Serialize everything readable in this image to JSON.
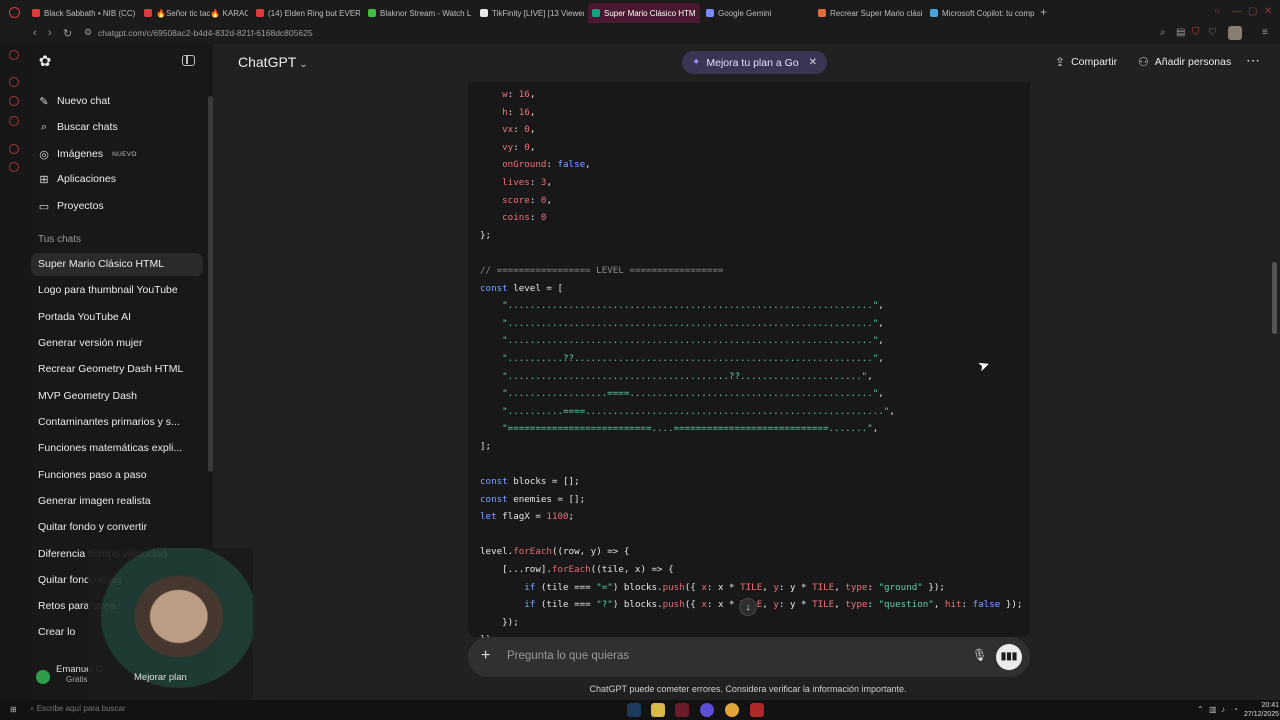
{
  "browser": {
    "tabs": [
      {
        "label": "Black Sabbath • NIB (CC) ..."
      },
      {
        "label": "🔥Señor tic tac🔥 KARAOK"
      },
      {
        "label": "(14) Elden Ring but EVERY"
      },
      {
        "label": "Blaknor Stream - Watch L"
      },
      {
        "label": "TikFinity [LIVE] [13 Viewer"
      },
      {
        "label": "Super Mario Clásico HTM"
      },
      {
        "label": "Google Gemini"
      },
      {
        "label": "Recrear Super Mario clási"
      },
      {
        "label": "Microsoft Copilot: tu comp"
      }
    ],
    "url": "chatgpt.com/c/69508ac2-b4d4-832d-821f-6168dc805625"
  },
  "sidebar": {
    "nav": [
      {
        "label": "Nuevo chat",
        "icon": "edit-icon"
      },
      {
        "label": "Buscar chats",
        "icon": "search-icon"
      },
      {
        "label": "Imágenes",
        "icon": "images-icon",
        "badge": "NUEVO"
      },
      {
        "label": "Aplicaciones",
        "icon": "apps-icon"
      },
      {
        "label": "Proyectos",
        "icon": "folder-icon"
      }
    ],
    "section_label": "Tus chats",
    "chats": [
      "Super Mario Clásico HTML",
      "Logo para thumbnail YouTube",
      "Portada YouTube AI",
      "Generar versión mujer",
      "Recrear Geometry Dash HTML",
      "MVP Geometry Dash",
      "Contaminantes primarios y s...",
      "Funciones matemáticas expli...",
      "Funciones paso a paso",
      "Generar imagen realista",
      "Quitar fondo y convertir",
      "Diferencia tiempo velocidad",
      "Quitar fondo imag",
      "Retos para strea",
      "Crear lo"
    ],
    "user_name": "Emanuel G",
    "user_plan": "Gratis",
    "upgrade_label": "Mejorar plan"
  },
  "header": {
    "title": "ChatGPT",
    "upsell": "Mejora tu plan a Go",
    "share": "Compartir",
    "add_people": "Añadir personas"
  },
  "code_lines": [
    [
      [
        "    ",
        ""
      ],
      [
        "w",
        "prop"
      ],
      [
        ": ",
        ""
      ],
      [
        "16",
        "num"
      ],
      [
        ",",
        ""
      ]
    ],
    [
      [
        "    ",
        ""
      ],
      [
        "h",
        "prop"
      ],
      [
        ": ",
        ""
      ],
      [
        "16",
        "num"
      ],
      [
        ",",
        ""
      ]
    ],
    [
      [
        "    ",
        ""
      ],
      [
        "vx",
        "prop"
      ],
      [
        ": ",
        ""
      ],
      [
        "0",
        "num"
      ],
      [
        ",",
        ""
      ]
    ],
    [
      [
        "    ",
        ""
      ],
      [
        "vy",
        "prop"
      ],
      [
        ": ",
        ""
      ],
      [
        "0",
        "num"
      ],
      [
        ",",
        ""
      ]
    ],
    [
      [
        "    ",
        ""
      ],
      [
        "onGround",
        "prop"
      ],
      [
        ": ",
        ""
      ],
      [
        "false",
        "bool"
      ],
      [
        ",",
        ""
      ]
    ],
    [
      [
        "    ",
        ""
      ],
      [
        "lives",
        "prop"
      ],
      [
        ": ",
        ""
      ],
      [
        "3",
        "num"
      ],
      [
        ",",
        ""
      ]
    ],
    [
      [
        "    ",
        ""
      ],
      [
        "score",
        "prop"
      ],
      [
        ": ",
        ""
      ],
      [
        "0",
        "num"
      ],
      [
        ",",
        ""
      ]
    ],
    [
      [
        "    ",
        ""
      ],
      [
        "coins",
        "prop"
      ],
      [
        ": ",
        ""
      ],
      [
        "0",
        "num"
      ]
    ],
    [
      [
        "};",
        ""
      ]
    ],
    [
      [
        "",
        ""
      ]
    ],
    [
      [
        "// ================= LEVEL =================",
        "cm"
      ]
    ],
    [
      [
        "const",
        "kw"
      ],
      [
        " level = [",
        ""
      ]
    ],
    [
      [
        "    ",
        ""
      ],
      [
        "\"..................................................................\"",
        "str"
      ],
      [
        ",",
        ""
      ]
    ],
    [
      [
        "    ",
        ""
      ],
      [
        "\"..................................................................\"",
        "str"
      ],
      [
        ",",
        ""
      ]
    ],
    [
      [
        "    ",
        ""
      ],
      [
        "\"..................................................................\"",
        "str"
      ],
      [
        ",",
        ""
      ]
    ],
    [
      [
        "    ",
        ""
      ],
      [
        "\"..........??......................................................\"",
        "str"
      ],
      [
        ",",
        ""
      ]
    ],
    [
      [
        "    ",
        ""
      ],
      [
        "\"........................................??......................\"",
        "str"
      ],
      [
        ",",
        ""
      ]
    ],
    [
      [
        "    ",
        ""
      ],
      [
        "\"..................====............................................\"",
        "str"
      ],
      [
        ",",
        ""
      ]
    ],
    [
      [
        "    ",
        ""
      ],
      [
        "\"..........====......................................................\"",
        "str"
      ],
      [
        ",",
        ""
      ]
    ],
    [
      [
        "    ",
        ""
      ],
      [
        "\"==========================....============================.......\"",
        "str"
      ],
      [
        ",",
        ""
      ]
    ],
    [
      [
        "];",
        ""
      ]
    ],
    [
      [
        "",
        ""
      ]
    ],
    [
      [
        "const",
        "kw"
      ],
      [
        " blocks = [];",
        ""
      ]
    ],
    [
      [
        "const",
        "kw"
      ],
      [
        " enemies = [];",
        ""
      ]
    ],
    [
      [
        "let",
        "kw"
      ],
      [
        " flagX = ",
        ""
      ],
      [
        "1100",
        "num"
      ],
      [
        ";",
        ""
      ]
    ],
    [
      [
        "",
        ""
      ]
    ],
    [
      [
        "level.",
        ""
      ],
      [
        "forEach",
        "fn"
      ],
      [
        "((row, y) => {",
        ""
      ]
    ],
    [
      [
        "    [...row].",
        ""
      ],
      [
        "forEach",
        "fn"
      ],
      [
        "((tile, x) => {",
        ""
      ]
    ],
    [
      [
        "        ",
        ""
      ],
      [
        "if",
        "kw"
      ],
      [
        " (tile === ",
        ""
      ],
      [
        "\"=\"",
        "str"
      ],
      [
        ") blocks.",
        ""
      ],
      [
        "push",
        "fn"
      ],
      [
        "({ ",
        ""
      ],
      [
        "x",
        "prop"
      ],
      [
        ": x * ",
        ""
      ],
      [
        "TILE",
        "prop"
      ],
      [
        ", ",
        ""
      ],
      [
        "y",
        "prop"
      ],
      [
        ": y * ",
        ""
      ],
      [
        "TILE",
        "prop"
      ],
      [
        ", ",
        ""
      ],
      [
        "type",
        "prop"
      ],
      [
        ": ",
        ""
      ],
      [
        "\"ground\"",
        "str"
      ],
      [
        " });",
        ""
      ]
    ],
    [
      [
        "        ",
        ""
      ],
      [
        "if",
        "kw"
      ],
      [
        " (tile === ",
        ""
      ],
      [
        "\"?\"",
        "str"
      ],
      [
        ") blocks.",
        ""
      ],
      [
        "push",
        "fn"
      ],
      [
        "({ ",
        ""
      ],
      [
        "x",
        "prop"
      ],
      [
        ": x * ",
        ""
      ],
      [
        "TILE",
        "prop"
      ],
      [
        ", ",
        ""
      ],
      [
        "y",
        "prop"
      ],
      [
        ": y * ",
        ""
      ],
      [
        "TILE",
        "prop"
      ],
      [
        ", ",
        ""
      ],
      [
        "type",
        "prop"
      ],
      [
        ": ",
        ""
      ],
      [
        "\"question\"",
        "str"
      ],
      [
        ", ",
        ""
      ],
      [
        "hit",
        "prop"
      ],
      [
        ": ",
        ""
      ],
      [
        "false",
        "bool"
      ],
      [
        " });",
        ""
      ]
    ],
    [
      [
        "    });",
        ""
      ]
    ],
    [
      [
        "});",
        ""
      ]
    ]
  ],
  "composer": {
    "placeholder": "Pregunta lo que quieras",
    "disclaimer": "ChatGPT puede cometer errores. Considera verificar la información importante."
  },
  "taskbar": {
    "search_placeholder": "Escribe aquí para buscar",
    "time": "20:41",
    "date": "27/12/2025"
  }
}
